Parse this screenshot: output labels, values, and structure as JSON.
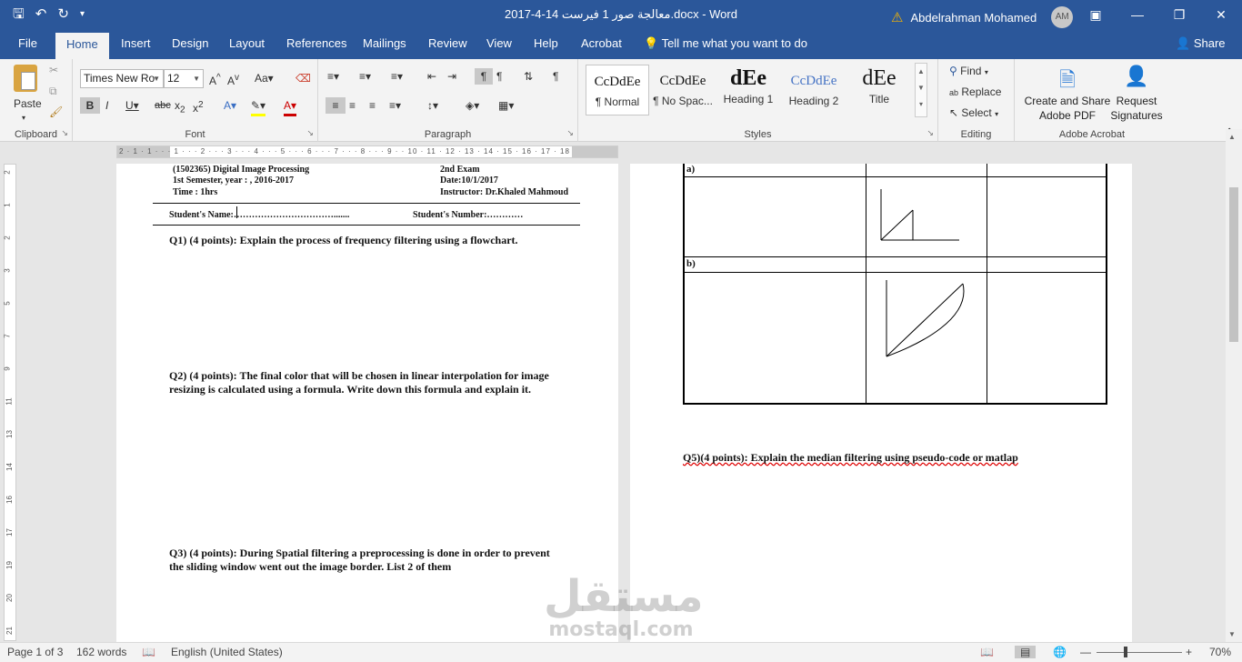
{
  "titlebar": {
    "document_title": "2017-4-14  معالجة صور 1 فيرست.docx  -  Word",
    "user_name": "Abdelrahman Mohamed",
    "avatar_initials": "AM"
  },
  "tabs": [
    "File",
    "Home",
    "Insert",
    "Design",
    "Layout",
    "References",
    "Mailings",
    "Review",
    "View",
    "Help",
    "Acrobat"
  ],
  "tell_me": "Tell me what you want to do",
  "share": "Share",
  "ribbon": {
    "clipboard": {
      "label": "Clipboard",
      "paste": "Paste"
    },
    "font": {
      "label": "Font",
      "name": "Times New Ro",
      "size": "12"
    },
    "paragraph": {
      "label": "Paragraph"
    },
    "styles": {
      "label": "Styles",
      "items": [
        {
          "sample": "CcDdEe",
          "name": "¶ Normal"
        },
        {
          "sample": "CcDdEe",
          "name": "¶ No Spac..."
        },
        {
          "sample": "dEe",
          "name": "Heading 1"
        },
        {
          "sample": "CcDdEe",
          "name": "Heading 2"
        },
        {
          "sample": "dEe",
          "name": "Title"
        }
      ]
    },
    "editing": {
      "label": "Editing",
      "find": "Find",
      "replace": "Replace",
      "select": "Select"
    },
    "acrobat": {
      "label": "Adobe Acrobat",
      "create": "Create and Share Adobe PDF",
      "request": "Request Signatures"
    }
  },
  "page1": {
    "course": "(1502365) Digital Image Processing",
    "exam": "2nd Exam",
    "semester": "1st Semester, year : , 2016-2017",
    "date": "Date:10/1/2017",
    "time": "Time : 1hrs",
    "instructor": "Instructor: Dr.Khaled Mahmoud",
    "student_name": "Student's Name:…………………………….......",
    "student_number": "Student's Number:…………",
    "q1": "Q1) (4 points): Explain the process of frequency filtering using a flowchart.",
    "q2": "Q2) (4 points): The final color that will be chosen in linear interpolation for image resizing is calculated using a formula. Write down this formula and explain it.",
    "q3": "Q3) (4 points): During Spatial filtering a preprocessing is done in order to prevent the sliding window went out the image border. List 2 of them"
  },
  "page2": {
    "row_a": "a)",
    "row_b": "b)",
    "q5": "Q5)(4 points): Explain the median filtering using pseudo-code or matlap"
  },
  "statusbar": {
    "page": "Page 1 of 3",
    "words": "162 words",
    "language": "English (United States)",
    "zoom": "70%"
  },
  "watermark": {
    "arabic": "مستقل",
    "latin": "mostaql.com"
  }
}
